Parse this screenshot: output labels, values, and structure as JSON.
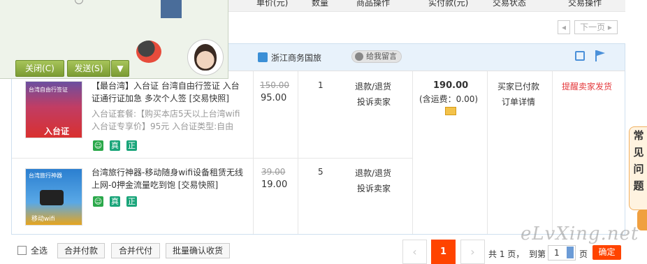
{
  "table_header": {
    "unit_price": "单价(元)",
    "quantity": "数量",
    "product_ops": "商品操作",
    "paid": "实付款(元)",
    "status": "交易状态",
    "trade_ops": "交易操作"
  },
  "pager_top": {
    "prev": "◂",
    "next": "下一页 ▸"
  },
  "order": {
    "shop_name": "浙江商务国旅",
    "message_label": "给我留言",
    "items": [
      {
        "title": "【最台湾】入台证 台湾自由行签证 入台证通行证加急 多次个人签 [交易快照]",
        "props": "入台证套餐:【购买本店5天以上台湾wifi入台证专享价】95元 入台证类型:自由",
        "original_price": "150.00",
        "price": "95.00",
        "quantity": "1",
        "op1": "退款/退货",
        "op2": "投诉卖家",
        "thumb_text": "入台证",
        "thumb_banner": "台湾自由行签证"
      },
      {
        "title": "台湾旅行神器-移动随身wifi设备租赁无线上网-0押金流量吃到饱 [交易快照]",
        "props": "",
        "original_price": "39.00",
        "price": "19.00",
        "quantity": "5",
        "op1": "退款/退货",
        "op2": "投诉卖家",
        "thumb_text": "移动wifi",
        "thumb_banner": "台湾旅行神器"
      }
    ],
    "badges": [
      "真",
      "正"
    ],
    "total": "190.00",
    "shipping": "(含运费：0.00)",
    "status_text": "买家已付款",
    "detail_link": "订单详情",
    "remind_link": "提醒卖家发货",
    "colors": {
      "remind": "#e4393c",
      "badge_green": "#2aa84a",
      "badge_teal": "#1aa57a"
    }
  },
  "popup": {
    "close_label": "关闭(C)",
    "send_label": "发送(S)"
  },
  "footer": {
    "select_all": "全选",
    "merge_pay": "合并付款",
    "merge_proxy": "合并代付",
    "batch_confirm": "批量确认收货",
    "current_page": "1",
    "total_pages": "共 1 页，",
    "goto": "到第",
    "page_input": "1",
    "page_unit": "页",
    "confirm": "确定"
  },
  "faq": [
    "常",
    "见",
    "问",
    "题"
  ],
  "watermark": "eLvXing.net"
}
